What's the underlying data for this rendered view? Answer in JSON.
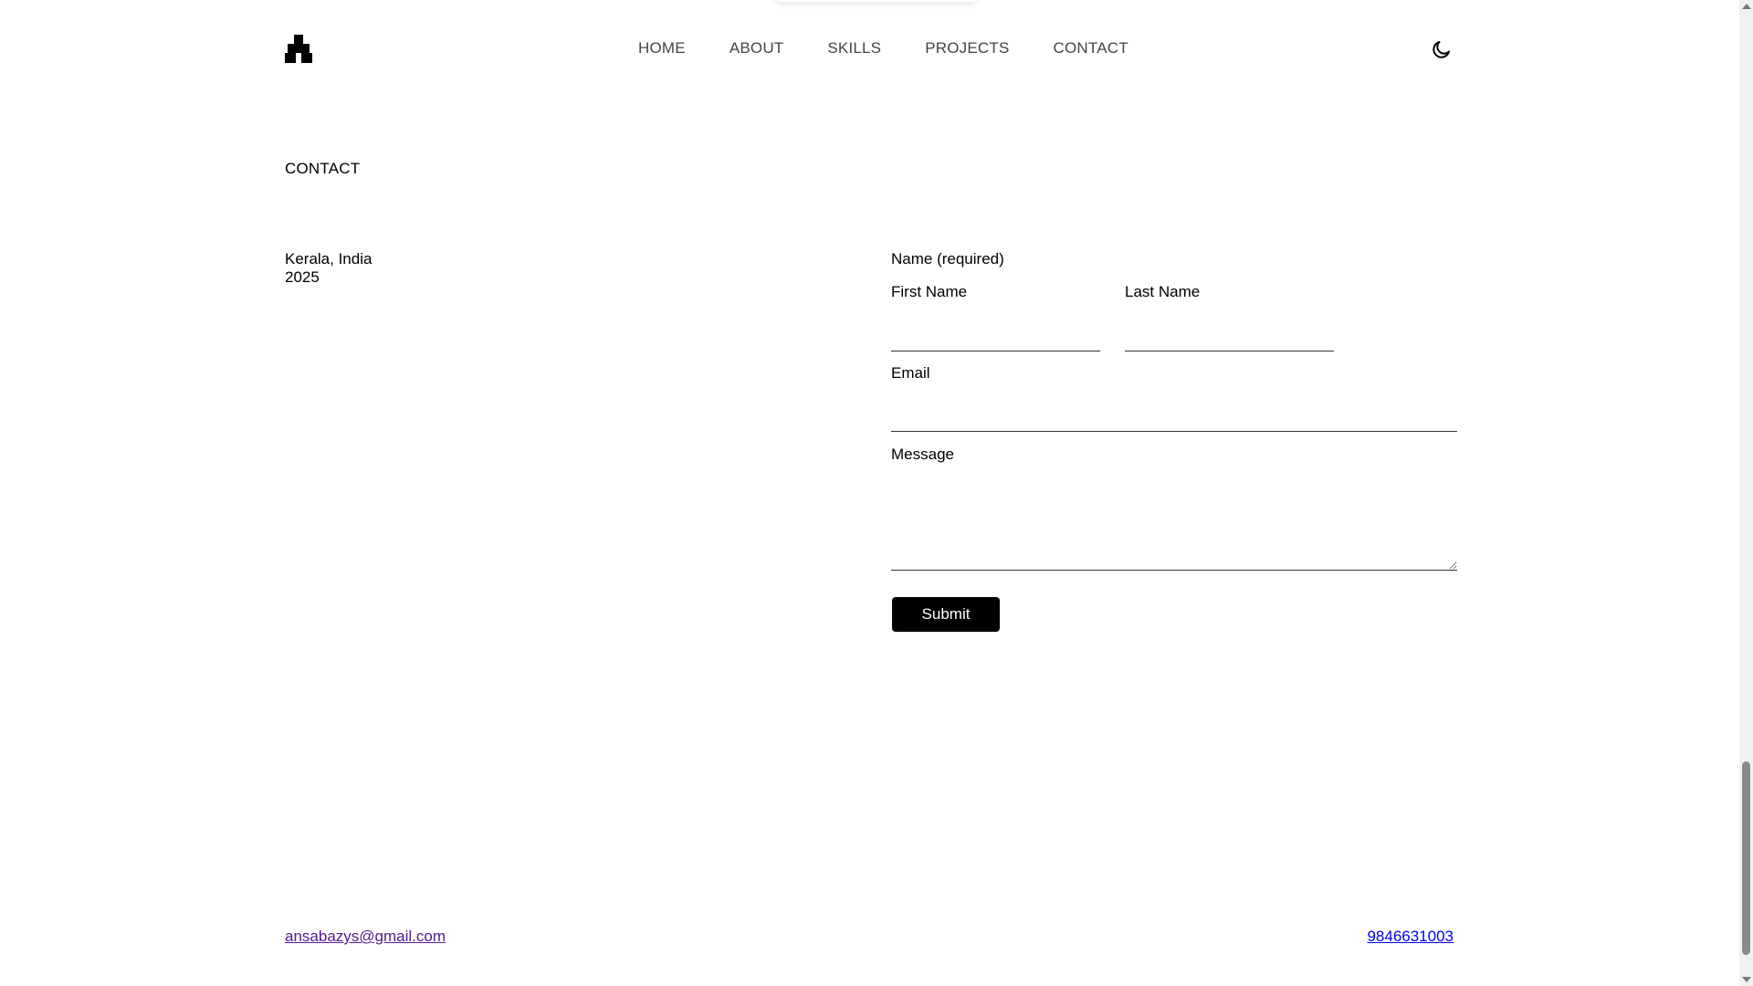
{
  "header": {
    "nav": [
      "HOME",
      "ABOUT",
      "SKILLS",
      "PROJECTS",
      "CONTACT"
    ]
  },
  "section": {
    "title": "CONTACT",
    "location_line1": "Kerala, India",
    "location_line2": "2025"
  },
  "form": {
    "name_label": "Name (required)",
    "first_name_label": "First Name",
    "last_name_label": "Last Name",
    "email_label": "Email",
    "message_label": "Message",
    "submit_label": "Submit"
  },
  "footer": {
    "email": "ansabazys@gmail.com",
    "phone": "9846631003"
  },
  "icons": {
    "logo": "brand-logo-icon",
    "theme": "moon-icon"
  }
}
